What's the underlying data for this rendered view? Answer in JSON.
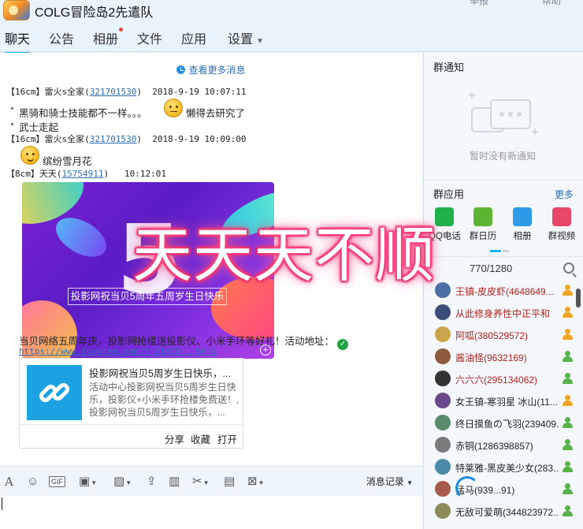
{
  "window": {
    "title": "COLG冒险岛2先遣队",
    "controls": [
      "举报",
      "帮助"
    ]
  },
  "tabs": [
    {
      "label": "聊天",
      "active": true
    },
    {
      "label": "公告"
    },
    {
      "label": "相册",
      "badge": "red-dot"
    },
    {
      "label": "文件"
    },
    {
      "label": "应用"
    },
    {
      "label": "设置",
      "has_dropdown": true
    }
  ],
  "chat": {
    "more_messages": "查看更多消息",
    "messages": [
      {
        "rank": "【16cm】",
        "name": "雷火s全家",
        "uid": "321701530",
        "time": "2018-9-19 10:07:11",
        "lines": [
          "黑骑和骑士技能都不一样。。。",
          "懒得去研究了",
          "武士走起"
        ]
      },
      {
        "rank": "【16cm】",
        "name": "雷火s全家",
        "uid": "321701530",
        "time": "2018-9-19 10:09:00",
        "lines": [
          "缤纷雪月花"
        ]
      },
      {
        "rank": "【8cm】",
        "name": "天天",
        "uid": "15754911",
        "time": "10:12:01",
        "image_caption": "投影网祝当贝5周年五周岁生日快乐",
        "text": "当贝网络五周年庆，投影网抢楼送投影仪、小米手环等好礼！活动地址：",
        "url": "https://www.touying.com/t-21408-1.html"
      }
    ],
    "card": {
      "title": "投影网祝当贝5周岁生日快乐，...",
      "desc": "活动中心投影网祝当贝5周岁生日快乐，投影仪+小米手环抢楼免费送！,投影网祝当贝5周岁生日快乐，...",
      "actions": [
        "分享",
        "收藏",
        "打开"
      ]
    }
  },
  "toolbar": {
    "history_label": "消息记录",
    "icons": [
      "font-icon",
      "emoji-icon",
      "gif-icon",
      "toolbox-icon",
      "image-icon",
      "upload-icon",
      "gift-icon",
      "screenshot-icon",
      "red-packet-icon",
      "shake-icon"
    ]
  },
  "right_panel": {
    "notice_title": "群通知",
    "notice_empty": "暂时没有新通知",
    "apps_title": "群应用",
    "apps_more": "更多",
    "apps": [
      {
        "label": "QQ电话",
        "color": "#20b24a"
      },
      {
        "label": "群日历",
        "color": "#5bb531"
      },
      {
        "label": "相册",
        "color": "#2d9be6"
      },
      {
        "label": "群视频",
        "color": "#e8476a"
      }
    ],
    "member_count": "770/1280",
    "members": [
      {
        "name": "王镇-皮皮虾(4648649...",
        "red": true,
        "role": "admin"
      },
      {
        "name": "从此修身养性中正平和",
        "red": true,
        "role": "admin"
      },
      {
        "name": "阿呱(380529572)",
        "red": true,
        "role": "admin"
      },
      {
        "name": "酱油怪(9632169)",
        "red": true,
        "role": "member"
      },
      {
        "name": "六六六(295134062)",
        "red": true,
        "role": "member"
      },
      {
        "name": "女王镇-寒羽星 冰山(11...",
        "red": false,
        "role": "admin"
      },
      {
        "name": "终日摸鱼の飞羽(239409...",
        "red": false,
        "role": "member"
      },
      {
        "name": "赤铜(1286398857)",
        "red": false,
        "role": "member"
      },
      {
        "name": "特莱雅-黑皮美少女(283...",
        "red": false,
        "role": "member"
      },
      {
        "name": "猛马(939...91)",
        "red": false,
        "role": "member"
      },
      {
        "name": "无敌可爱萌(344823972...",
        "red": false,
        "role": "member"
      }
    ]
  },
  "overlay_text": "天天天不顺",
  "colors": {
    "accent": "#12b7f5",
    "link": "#2d6fb5",
    "admin_name": "#b4201a",
    "overlay_glow": "#ff3e7a"
  }
}
